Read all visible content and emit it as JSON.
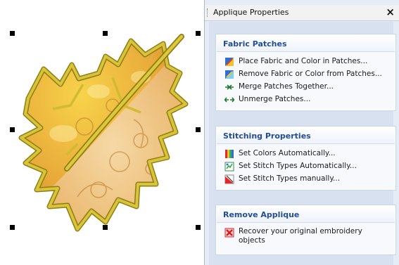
{
  "panel": {
    "title": "Applique Properties",
    "close_glyph": "×",
    "groups": [
      {
        "title": "Fabric Patches",
        "items": [
          {
            "label": "Place Fabric and Color in Patches...",
            "icon": "place-fabric-icon"
          },
          {
            "label": "Remove Fabric or Color from Patches...",
            "icon": "remove-fabric-icon"
          },
          {
            "label": "Merge Patches Together...",
            "icon": "merge-arrows-icon"
          },
          {
            "label": "Unmerge Patches...",
            "icon": "unmerge-arrows-icon"
          }
        ]
      },
      {
        "title": "Stitching Properties",
        "items": [
          {
            "label": "Set Colors Automatically...",
            "icon": "rainbow-colors-icon"
          },
          {
            "label": "Set Stitch Types Automatically...",
            "icon": "stitch-types-auto-icon"
          },
          {
            "label": "Set Stitch Types manually...",
            "icon": "stitch-types-manual-icon"
          }
        ]
      },
      {
        "title": "Remove Applique",
        "items": [
          {
            "label": "Recover your original embroidery objects",
            "icon": "red-x-icon"
          }
        ]
      }
    ]
  },
  "colors": {
    "group_title": "#214d9c",
    "panel_bg": "#e6ecf5",
    "leaf_outline": "#c9b62a",
    "leaf_fill": "#e9a73a"
  }
}
